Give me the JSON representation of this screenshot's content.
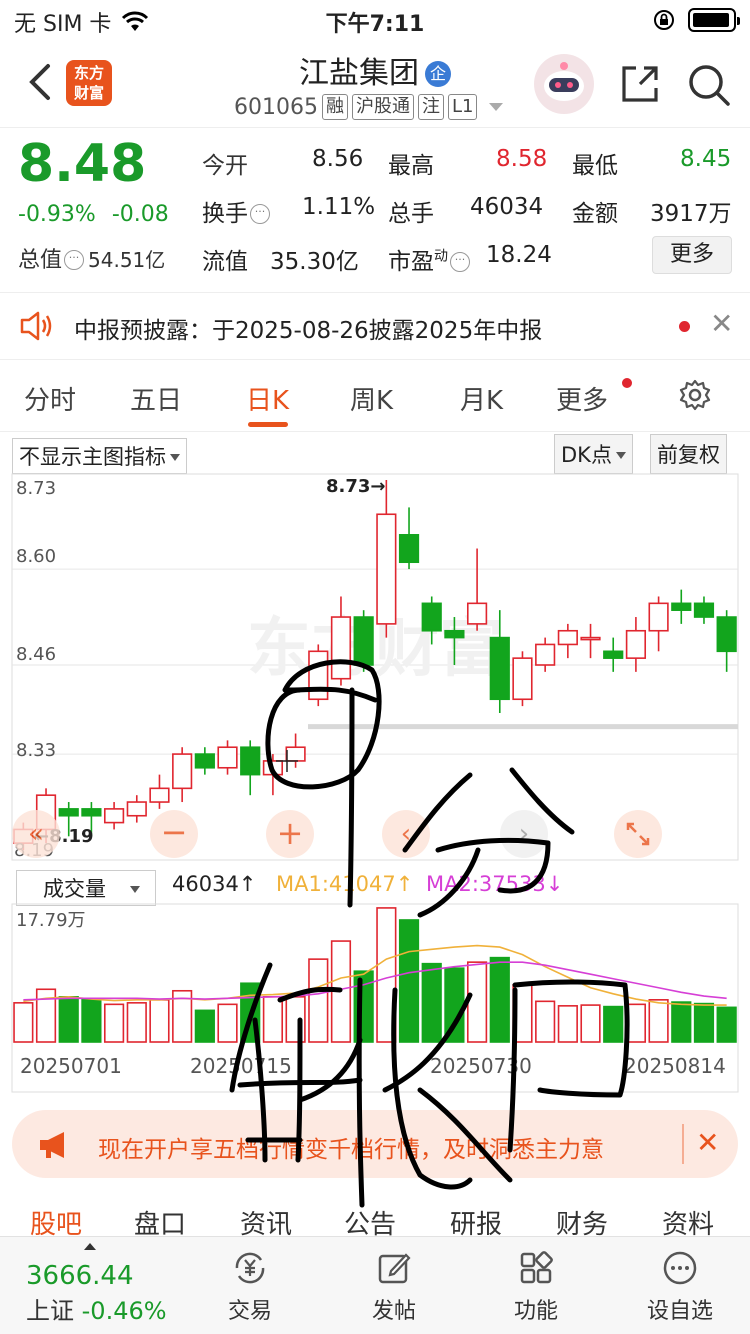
{
  "status": {
    "carrier": "无 SIM 卡",
    "time": "下午7:11"
  },
  "header": {
    "logo_text": "东方\n财富",
    "stock_name": "江盐集团",
    "enterprise_badge": "企",
    "code": "601065",
    "tags": [
      "融",
      "沪股通",
      "注",
      "L1"
    ]
  },
  "quote": {
    "price": "8.48",
    "change_pct": "-0.93%",
    "change_abs": "-0.08",
    "total_value_label": "总值",
    "total_value": "54.51亿",
    "open_label": "今开",
    "open": "8.56",
    "high_label": "最高",
    "high": "8.58",
    "low_label": "最低",
    "low": "8.45",
    "turnover_label": "换手",
    "turnover": "1.11%",
    "volume_label": "总手",
    "volume": "46034",
    "amount_label": "金额",
    "amount": "3917万",
    "float_label": "流值",
    "float_value": "35.30亿",
    "pe_label": "市盈",
    "pe_sup": "动",
    "pe": "18.24",
    "more_button": "更多"
  },
  "notice": {
    "text": "中报预披露：于2025-08-26披露2025年中报"
  },
  "tabs": [
    "分时",
    "五日",
    "日K",
    "周K",
    "月K",
    "更多"
  ],
  "active_tab": "日K",
  "chart": {
    "indicator_select": "不显示主图指标",
    "dk_button": "DK点",
    "adjust_button": "前复权",
    "y_labels": [
      "8.73",
      "8.60",
      "8.46",
      "8.33",
      "8.19"
    ],
    "max_marker": "8.73→",
    "min_marker": "←8.19",
    "volume_select": "成交量",
    "volume_value": "46034↑",
    "ma1": "MA1:41047↑",
    "ma2": "MA2:37533↓",
    "vol_max_label": "17.79万",
    "dates": [
      "20250701",
      "20250715",
      "20250730",
      "20250814"
    ],
    "colors": {
      "up": "#e0262f",
      "down": "#12a51d",
      "ma1": "#f0b13a",
      "ma2": "#d63fd6"
    }
  },
  "chart_data": {
    "type": "candlestick",
    "title": "",
    "ylim": [
      8.19,
      8.73
    ],
    "candles": [
      {
        "o": 8.2,
        "c": 8.22,
        "h": 8.23,
        "l": 8.19
      },
      {
        "o": 8.22,
        "c": 8.27,
        "h": 8.28,
        "l": 8.2
      },
      {
        "o": 8.25,
        "c": 8.24,
        "h": 8.26,
        "l": 8.21
      },
      {
        "o": 8.25,
        "c": 8.24,
        "h": 8.26,
        "l": 8.21
      },
      {
        "o": 8.23,
        "c": 8.25,
        "h": 8.26,
        "l": 8.22
      },
      {
        "o": 8.24,
        "c": 8.26,
        "h": 8.27,
        "l": 8.23
      },
      {
        "o": 8.26,
        "c": 8.28,
        "h": 8.3,
        "l": 8.25
      },
      {
        "o": 8.28,
        "c": 8.33,
        "h": 8.34,
        "l": 8.26
      },
      {
        "o": 8.33,
        "c": 8.31,
        "h": 8.34,
        "l": 8.3
      },
      {
        "o": 8.31,
        "c": 8.34,
        "h": 8.35,
        "l": 8.3
      },
      {
        "o": 8.34,
        "c": 8.3,
        "h": 8.35,
        "l": 8.27
      },
      {
        "o": 8.3,
        "c": 8.32,
        "h": 8.33,
        "l": 8.27
      },
      {
        "o": 8.32,
        "c": 8.34,
        "h": 8.36,
        "l": 8.31
      },
      {
        "o": 8.41,
        "c": 8.48,
        "h": 8.49,
        "l": 8.4
      },
      {
        "o": 8.44,
        "c": 8.53,
        "h": 8.56,
        "l": 8.43
      },
      {
        "o": 8.53,
        "c": 8.46,
        "h": 8.54,
        "l": 8.45
      },
      {
        "o": 8.52,
        "c": 8.68,
        "h": 8.73,
        "l": 8.5
      },
      {
        "o": 8.65,
        "c": 8.61,
        "h": 8.69,
        "l": 8.6
      },
      {
        "o": 8.55,
        "c": 8.51,
        "h": 8.56,
        "l": 8.49
      },
      {
        "o": 8.51,
        "c": 8.5,
        "h": 8.53,
        "l": 8.46
      },
      {
        "o": 8.52,
        "c": 8.55,
        "h": 8.63,
        "l": 8.51
      },
      {
        "o": 8.5,
        "c": 8.41,
        "h": 8.54,
        "l": 8.39
      },
      {
        "o": 8.41,
        "c": 8.47,
        "h": 8.48,
        "l": 8.4
      },
      {
        "o": 8.46,
        "c": 8.49,
        "h": 8.5,
        "l": 8.45
      },
      {
        "o": 8.49,
        "c": 8.51,
        "h": 8.52,
        "l": 8.47
      },
      {
        "o": 8.5,
        "c": 8.5,
        "h": 8.52,
        "l": 8.47
      },
      {
        "o": 8.48,
        "c": 8.47,
        "h": 8.5,
        "l": 8.45
      },
      {
        "o": 8.47,
        "c": 8.51,
        "h": 8.53,
        "l": 8.45
      },
      {
        "o": 8.51,
        "c": 8.55,
        "h": 8.56,
        "l": 8.48
      },
      {
        "o": 8.55,
        "c": 8.54,
        "h": 8.57,
        "l": 8.52
      },
      {
        "o": 8.55,
        "c": 8.53,
        "h": 8.56,
        "l": 8.52
      },
      {
        "o": 8.53,
        "c": 8.48,
        "h": 8.54,
        "l": 8.45
      }
    ],
    "volume": [
      5.2,
      7.0,
      6.0,
      5.6,
      5.0,
      5.2,
      5.6,
      6.8,
      4.2,
      5.0,
      7.8,
      6.0,
      6.0,
      11.0,
      13.4,
      9.4,
      17.8,
      16.2,
      10.4,
      9.8,
      10.6,
      11.2,
      7.6,
      5.4,
      4.8,
      4.9,
      4.7,
      5.0,
      5.6,
      5.3,
      5.1,
      4.6
    ],
    "ma1": [
      5.4,
      5.8,
      6.0,
      5.7,
      5.5,
      5.6,
      5.6,
      5.8,
      5.6,
      5.8,
      6.2,
      6.3,
      6.5,
      7.3,
      8.5,
      9.0,
      11.0,
      12.0,
      12.3,
      12.6,
      12.8,
      12.6,
      11.6,
      10.0,
      8.6,
      7.2,
      6.4,
      5.7,
      5.2,
      5.0,
      4.9,
      4.9
    ],
    "ma2": [
      5.6,
      5.7,
      5.8,
      5.8,
      5.8,
      5.8,
      5.7,
      5.8,
      5.7,
      5.8,
      5.9,
      6.0,
      6.1,
      6.4,
      7.0,
      7.6,
      8.5,
      9.2,
      9.6,
      10.0,
      10.3,
      10.6,
      10.6,
      10.2,
      9.6,
      9.0,
      8.4,
      7.8,
      7.2,
      6.6,
      6.1,
      5.8
    ]
  },
  "ad": {
    "text": "现在开户享五档行情变千档行情，及时洞悉主力意"
  },
  "subtabs": [
    "股吧",
    "盘口",
    "资讯",
    "公告",
    "研报",
    "财务",
    "资料"
  ],
  "bottom": {
    "index_value": "3666.44",
    "index_name": "上证",
    "index_change": "-0.46%",
    "items": [
      "交易",
      "发帖",
      "功能",
      "设自选"
    ]
  }
}
